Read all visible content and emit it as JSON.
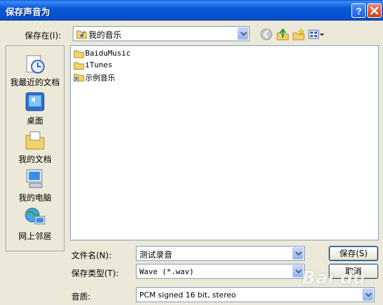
{
  "window": {
    "title": "保存声音为",
    "help_label": "?",
    "close_label": "×"
  },
  "lookin": {
    "label": "保存在(I):",
    "value": "我的音乐"
  },
  "toolbar": {
    "icons": [
      "back-icon",
      "up-folder-icon",
      "new-folder-icon",
      "views-menu-icon"
    ]
  },
  "places": [
    {
      "name": "recent-icon",
      "label": "我最近的文档"
    },
    {
      "name": "desktop-icon",
      "label": "桌面"
    },
    {
      "name": "my-documents-icon",
      "label": "我的文档"
    },
    {
      "name": "my-computer-icon",
      "label": "我的电脑"
    },
    {
      "name": "network-icon",
      "label": "网上邻居"
    }
  ],
  "files": [
    {
      "name": "BaiduMusic",
      "icon": "folder-icon"
    },
    {
      "name": "iTunes",
      "icon": "folder-icon"
    },
    {
      "name": "示例音乐",
      "icon": "folder-shortcut-icon"
    }
  ],
  "filename": {
    "label": "文件名(N):",
    "value": "测试录音"
  },
  "filetype": {
    "label": "保存类型(T):",
    "value": "Wave (*.wav)"
  },
  "quality": {
    "label": "音质:",
    "value": "PCM signed 16 bit, stereo"
  },
  "buttons": {
    "save": "保存(S)",
    "cancel": "取消"
  },
  "watermark": "Bai du"
}
